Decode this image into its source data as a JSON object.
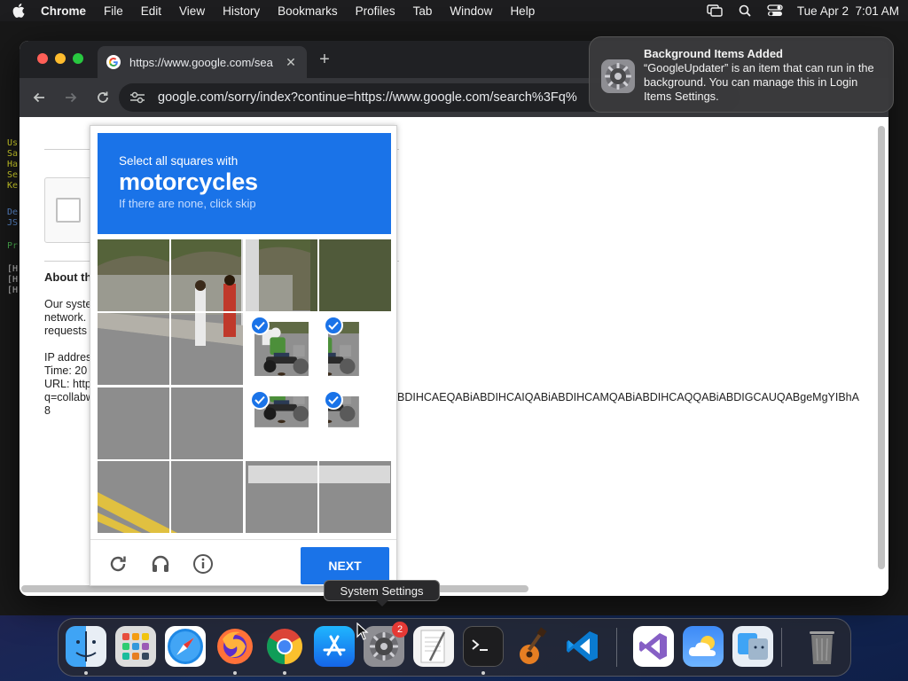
{
  "menubar": {
    "app_name": "Chrome",
    "items": [
      "File",
      "Edit",
      "View",
      "History",
      "Bookmarks",
      "Profiles",
      "Tab",
      "Window",
      "Help"
    ],
    "clock": "Tue Apr 2  7:01 AM"
  },
  "background_terminal": {
    "lines": [
      {
        "text": "Us",
        "color": "#d8d82a"
      },
      {
        "text": "Sa",
        "color": "#d8d82a"
      },
      {
        "text": "Ha",
        "color": "#d8d82a"
      },
      {
        "text": "Se",
        "color": "#d8d82a"
      },
      {
        "text": "Ke",
        "color": "#d8d82a"
      },
      {
        "text": "De",
        "color": "#5b8ed6"
      },
      {
        "text": "JS",
        "color": "#5b8ed6"
      },
      {
        "text": "Pr",
        "color": "#4caf50"
      },
      {
        "text": "[H",
        "color": "#cfcfcf"
      },
      {
        "text": "[H",
        "color": "#cfcfcf"
      },
      {
        "text": "[H",
        "color": "#cfcfcf"
      }
    ]
  },
  "browser": {
    "tab_title": "https://www.google.com/sea",
    "url": "google.com/sorry/index?continue=https://www.google.com/search%3Fq%"
  },
  "page": {
    "about_heading": "About th",
    "para1": [
      "Our syste",
      "network.",
      "requests"
    ],
    "ip_lines": [
      "IP addres",
      "Time: 20",
      "URL: http",
      "q=collabw"
    ],
    "long_tail": "BDIHCAEQABiABDIHCAIQABiABDIHCAMQABiABDIHCAQQABiABDIGCAUQABgeMgYIBhA",
    "trailing": "8"
  },
  "captcha": {
    "prompt_line1": "Select all squares with",
    "target_object": "motorcycles",
    "prompt_line3": "If there are none, click skip",
    "selected_tiles": [
      6,
      7,
      10,
      11
    ],
    "next_label": "NEXT",
    "icons": [
      "reload-icon",
      "audio-icon",
      "info-icon"
    ]
  },
  "notification": {
    "title": "Background Items Added",
    "body": "“GoogleUpdater” is an item that can run in the background. You can manage this in Login Items Settings."
  },
  "tooltip": {
    "text": "System Settings"
  },
  "dock": {
    "apps": [
      "Finder",
      "Launchpad",
      "Safari",
      "Firefox",
      "Chrome",
      "App Store",
      "System Settings",
      "TextEdit",
      "Terminal",
      "GarageBand",
      "Visual Studio Code",
      "Visual Studio",
      "Weather",
      "Migration Assistant",
      "Trash"
    ],
    "system_settings_badge": "2"
  }
}
